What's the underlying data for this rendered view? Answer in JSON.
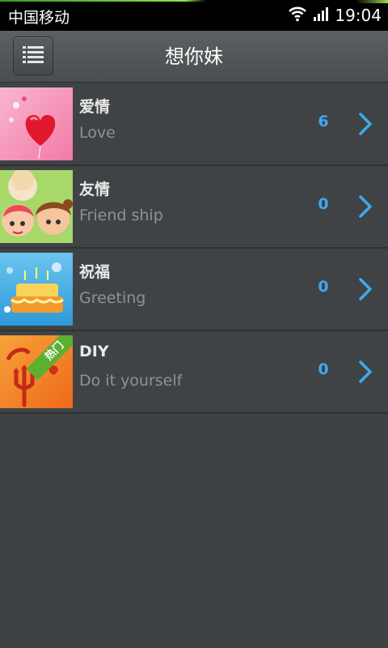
{
  "status_bar": {
    "carrier": "中国移动",
    "time": "19:04"
  },
  "header": {
    "title": "想你妹",
    "menu_icon": "list-icon"
  },
  "categories": [
    {
      "title": "爱情",
      "subtitle": "Love",
      "count": "6",
      "thumbnail": "heart-balloon-image"
    },
    {
      "title": "友情",
      "subtitle": "Friend ship",
      "count": "0",
      "thumbnail": "cartoon-friends-image"
    },
    {
      "title": "祝福",
      "subtitle": "Greeting",
      "count": "0",
      "thumbnail": "birthday-cake-image"
    },
    {
      "title": "DIY",
      "subtitle": "Do it yourself",
      "count": "0",
      "thumbnail": "devil-trident-image",
      "badge": "热门"
    }
  ],
  "colors": {
    "accent": "#3fa9ef",
    "background": "#3f4244"
  }
}
